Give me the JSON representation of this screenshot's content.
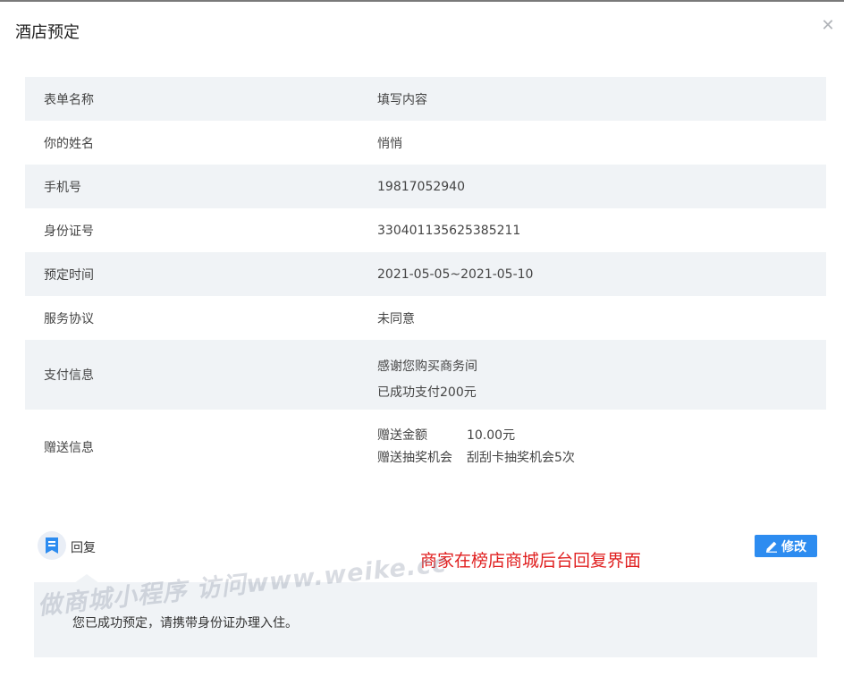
{
  "modal": {
    "title": "酒店预定",
    "close_icon": "close-icon"
  },
  "form": {
    "header": {
      "label": "表单名称",
      "value": "填写内容"
    },
    "rows": [
      {
        "label": "你的姓名",
        "value": "悄悄"
      },
      {
        "label": "手机号",
        "value": "19817052940"
      },
      {
        "label": "身份证号",
        "value": "330401135625385211"
      },
      {
        "label": "预定时间",
        "value": "2021-05-05~2021-05-10"
      },
      {
        "label": "服务协议",
        "value": "未同意"
      }
    ],
    "payment": {
      "label": "支付信息",
      "line1": "感谢您购买商务间",
      "line2": "已成功支付200元"
    },
    "gift": {
      "label": "赠送信息",
      "items": [
        {
          "name": "赠送金额",
          "value": "10.00元"
        },
        {
          "name": "赠送抽奖机会",
          "value": "刮刮卡抽奖机会5次"
        }
      ]
    }
  },
  "reply": {
    "icon": "reply-bookmark-icon",
    "label": "回复",
    "edit_icon": "pencil-icon",
    "edit_label": "修改",
    "message": "您已成功预定，请携带身份证办理入住。"
  },
  "annotation": "商家在榜店商城后台回复界面",
  "watermark": "做商城小程序 访问www.weike.cc",
  "colors": {
    "accent": "#2d8cf0",
    "row_shade": "#f0f3f6",
    "annotation": "#e02020"
  }
}
